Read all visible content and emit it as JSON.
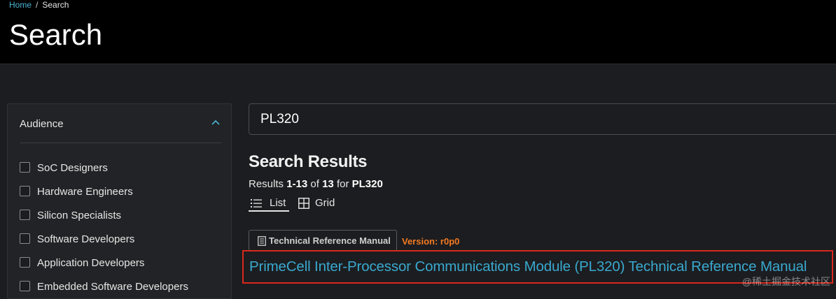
{
  "breadcrumb": {
    "home": "Home",
    "separator": "/",
    "current": "Search"
  },
  "page": {
    "title": "Search"
  },
  "sidebar": {
    "section_title": "Audience",
    "chevron_icon": "chevron-up-icon",
    "filters": [
      {
        "label": "SoC Designers",
        "checked": false
      },
      {
        "label": "Hardware Engineers",
        "checked": false
      },
      {
        "label": "Silicon Specialists",
        "checked": false
      },
      {
        "label": "Software Developers",
        "checked": false
      },
      {
        "label": "Application Developers",
        "checked": false
      },
      {
        "label": "Embedded Software Developers",
        "checked": false
      }
    ]
  },
  "search": {
    "value": "PL320"
  },
  "results": {
    "title": "Search Results",
    "summary": {
      "prefix": "Results",
      "range": "1-13",
      "of_word": "of",
      "total": "13",
      "for_word": "for",
      "query": "PL320"
    },
    "views": {
      "list_label": "List",
      "grid_label": "Grid",
      "active": "list"
    },
    "items": [
      {
        "tag": "Technical Reference Manual",
        "version": "Version: r0p0",
        "title": "PrimeCell Inter-Processor Communications Module (PL320) Technical Reference Manual"
      }
    ]
  },
  "watermark": "@稀土掘金技术社区",
  "colors": {
    "accent_link": "#39a9cf",
    "version": "#f47a20",
    "highlight_border": "#d9281c",
    "header_bg": "#000000",
    "body_bg": "#1c1d20"
  }
}
